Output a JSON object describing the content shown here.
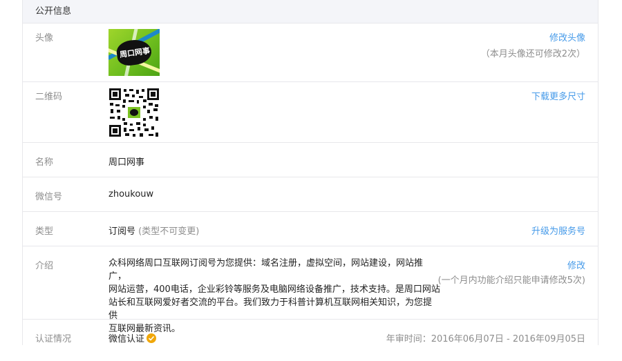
{
  "panel": {
    "title": "公开信息"
  },
  "avatar": {
    "label": "头像",
    "image_text": "周口网事",
    "change_link": "修改头像",
    "note": "（本月头像还可修改2次）"
  },
  "qrcode": {
    "label": "二维码",
    "download_link": "下载更多尺寸"
  },
  "name": {
    "label": "名称",
    "value": "周口网事"
  },
  "wechat_id": {
    "label": "微信号",
    "value": "zhoukouw"
  },
  "type": {
    "label": "类型",
    "value": "订阅号",
    "note": "(类型不可变更)",
    "upgrade_link": "升级为服务号"
  },
  "intro": {
    "label": "介绍",
    "lines": [
      "众科网络周口互联网订阅号为您提供：域名注册，虚拟空间，网站建设，网站推广，",
      "网站运营，400电话，企业彩铃等服务及电脑网络设备推广，技术支持。是周口网站",
      "站长和互联网爱好者交流的平台。我们致力于科普计算机互联网相关知识，为您提供",
      "互联网最新资讯。"
    ],
    "edit_link": "修改",
    "note": "(一个月内功能介绍只能申请修改5次)"
  },
  "verification": {
    "label": "认证情况",
    "value": "微信认证",
    "review_time": "年审时间：2016年06月07日 - 2016年09月05日"
  },
  "colors": {
    "link": "#459ae9",
    "border": "#e7e7eb",
    "header_bg": "#f4f5f9",
    "badge": "#f0a70a"
  }
}
